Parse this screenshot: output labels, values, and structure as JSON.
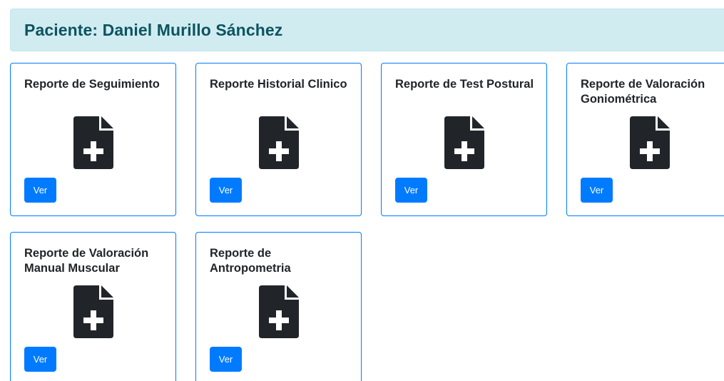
{
  "patient": {
    "title": "Paciente: Daniel Murillo Sánchez"
  },
  "colors": {
    "banner_bg": "#d1ecf1",
    "banner_text": "#0c5460",
    "card_border": "#007bff",
    "button_bg": "#007bff",
    "icon_fill": "#212529"
  },
  "icons": {
    "card_icon": "file-medical-icon"
  },
  "reports": [
    {
      "title": "Reporte de Seguimiento",
      "button_label": "Ver"
    },
    {
      "title": "Reporte Historial Clinico",
      "button_label": "Ver"
    },
    {
      "title": "Reporte de Test Postural",
      "button_label": "Ver"
    },
    {
      "title": "Reporte de Valoración Goniométrica",
      "button_label": "Ver"
    },
    {
      "title": "Reporte de Valoración Manual Muscular",
      "button_label": "Ver"
    },
    {
      "title": "Reporte de Antropometria",
      "button_label": "Ver"
    }
  ]
}
